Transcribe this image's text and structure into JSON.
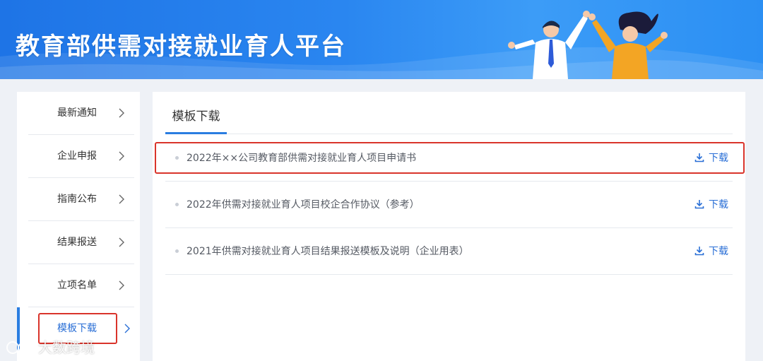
{
  "banner": {
    "title": "教育部供需对接就业育人平台"
  },
  "sidebar": {
    "items": [
      {
        "label": "最新通知",
        "active": false
      },
      {
        "label": "企业申报",
        "active": false
      },
      {
        "label": "指南公布",
        "active": false
      },
      {
        "label": "结果报送",
        "active": false
      },
      {
        "label": "立项名单",
        "active": false
      },
      {
        "label": "模板下载",
        "active": true
      }
    ]
  },
  "main": {
    "tab_label": "模板下载",
    "files": [
      {
        "name": "2022年××公司教育部供需对接就业育人项目申请书",
        "download_label": "下载"
      },
      {
        "name": "2022年供需对接就业育人项目校企合作协议（参考）",
        "download_label": "下载"
      },
      {
        "name": "2021年供需对接就业育人项目结果报送模板及说明（企业用表）",
        "download_label": "下载"
      }
    ]
  },
  "watermark": {
    "text": "大数跨境"
  },
  "colors": {
    "accent": "#2a7de1",
    "link": "#2a6fd6",
    "highlight_border": "#d9342b",
    "banner": "#2a86f0"
  },
  "icons": [
    "chevron-right-icon",
    "download-icon",
    "watermark-logo-icon"
  ]
}
